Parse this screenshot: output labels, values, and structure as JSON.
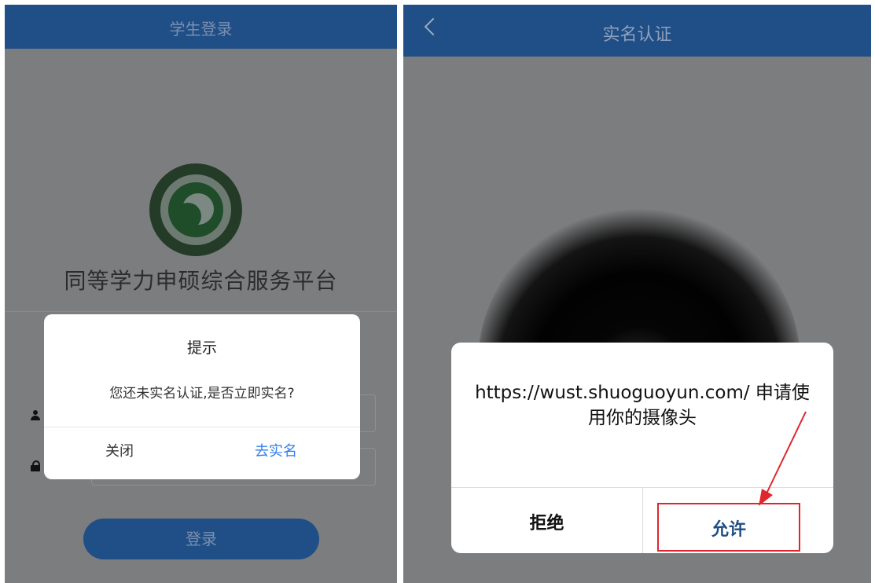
{
  "left_screen": {
    "header_title": "学生登录",
    "platform_title": "同等学力申硕综合服务平台",
    "login_button": "登录",
    "dialog": {
      "title": "提示",
      "message": "您还未实名认证,是否立即实名?",
      "close_label": "关闭",
      "confirm_label": "去实名"
    }
  },
  "right_screen": {
    "header_title": "实名认证",
    "dialog": {
      "message": "https://wust.shuoguoyun.com/ 申请使用你的摄像头",
      "deny_label": "拒绝",
      "allow_label": "允许"
    }
  },
  "colors": {
    "header_blue": "#1f4f86",
    "overlay_gray": "#7c7d7f",
    "link_blue": "#2f7ef0",
    "highlight_red": "#e0262c"
  }
}
